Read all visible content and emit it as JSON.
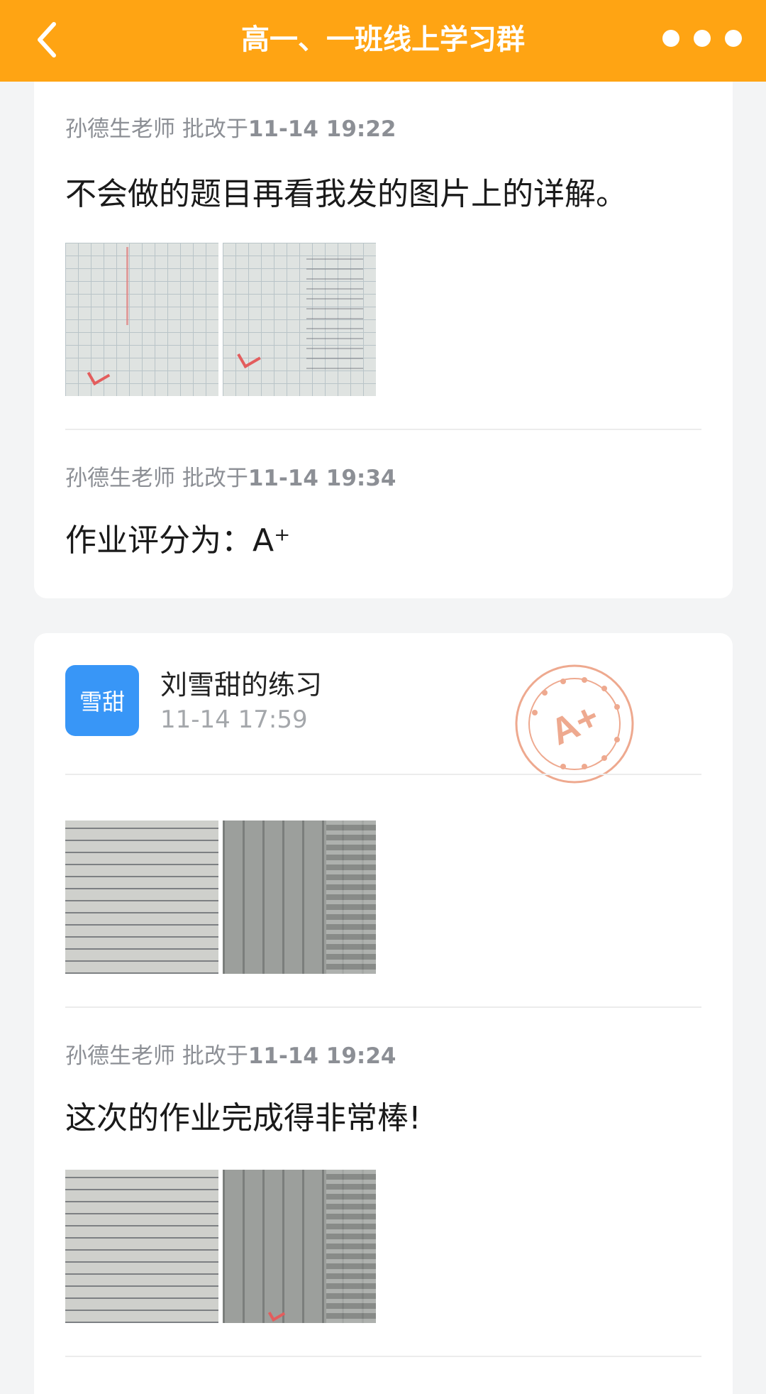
{
  "header": {
    "title": "高一、一班线上学习群"
  },
  "card1": {
    "review1": {
      "teacher": "孙德生老师 批改于",
      "time": "11-14 19:22",
      "message": "不会做的题目再看我发的图片上的详解。"
    },
    "review2": {
      "teacher": "孙德生老师 批改于",
      "time": "11-14 19:34",
      "message": "作业评分为：A⁺"
    }
  },
  "card2": {
    "avatar_text": "雪甜",
    "exercise_title": "刘雪甜的练习",
    "exercise_time": "11-14 17:59",
    "stamp_grade": "A+",
    "review": {
      "teacher": "孙德生老师 批改于",
      "time": "11-14 19:24",
      "message": "这次的作业完成得非常棒!"
    }
  },
  "colors": {
    "header_bg": "#ffa413",
    "avatar_bg": "#3896f7",
    "stamp": "#eea98f"
  },
  "icons": {
    "back": "back-chevron-icon",
    "more": "more-dots-icon"
  }
}
